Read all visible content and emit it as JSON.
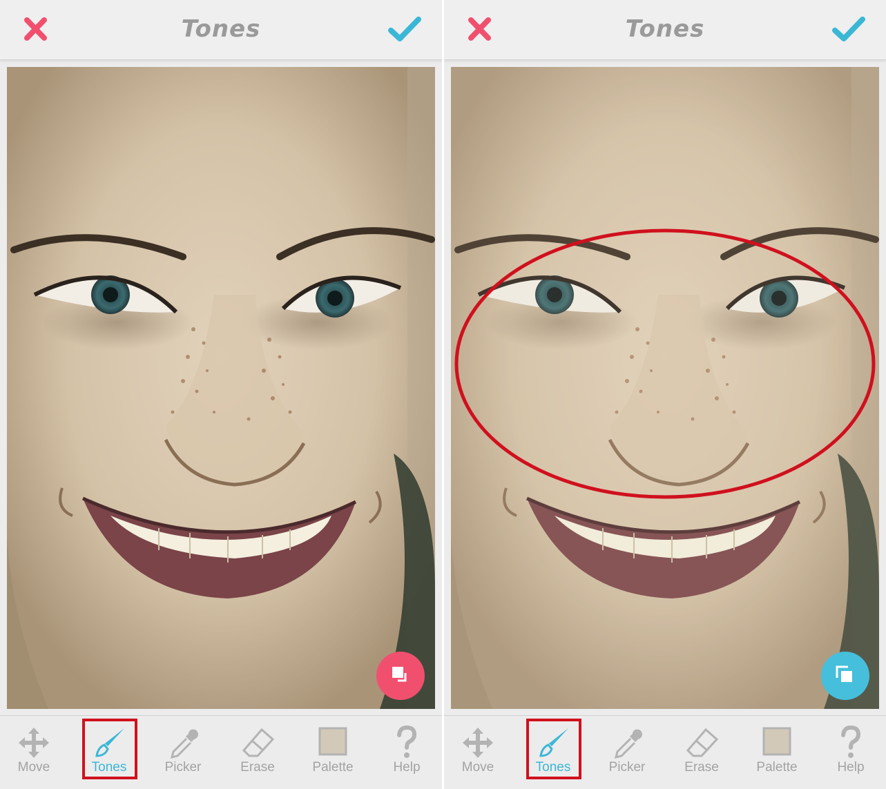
{
  "screens": [
    {
      "title": "Tones",
      "close_icon": "close-x-icon",
      "done_icon": "checkmark-icon",
      "compare_button_color": "#f0506e",
      "tools": [
        {
          "label": "Move",
          "icon": "move-arrows-icon",
          "active": false
        },
        {
          "label": "Tones",
          "icon": "brush-icon",
          "active": true
        },
        {
          "label": "Picker",
          "icon": "eyedropper-icon",
          "active": false
        },
        {
          "label": "Erase",
          "icon": "eraser-icon",
          "active": false
        },
        {
          "label": "Palette",
          "icon": "palette-swatch-icon",
          "active": false
        },
        {
          "label": "Help",
          "icon": "question-mark-icon",
          "active": false
        }
      ]
    },
    {
      "title": "Tones",
      "close_icon": "close-x-icon",
      "done_icon": "checkmark-icon",
      "compare_button_color": "#45bfdc",
      "tools": [
        {
          "label": "Move",
          "icon": "move-arrows-icon",
          "active": false
        },
        {
          "label": "Tones",
          "icon": "brush-icon",
          "active": true
        },
        {
          "label": "Picker",
          "icon": "eyedropper-icon",
          "active": false
        },
        {
          "label": "Erase",
          "icon": "eraser-icon",
          "active": false
        },
        {
          "label": "Palette",
          "icon": "palette-swatch-icon",
          "active": false
        },
        {
          "label": "Help",
          "icon": "question-mark-icon",
          "active": false
        }
      ]
    }
  ],
  "colors": {
    "accent_blue": "#3bb7d6",
    "close_red": "#f0506e",
    "annotation_red": "#d0101e",
    "inactive_gray": "#a3a3a3"
  }
}
